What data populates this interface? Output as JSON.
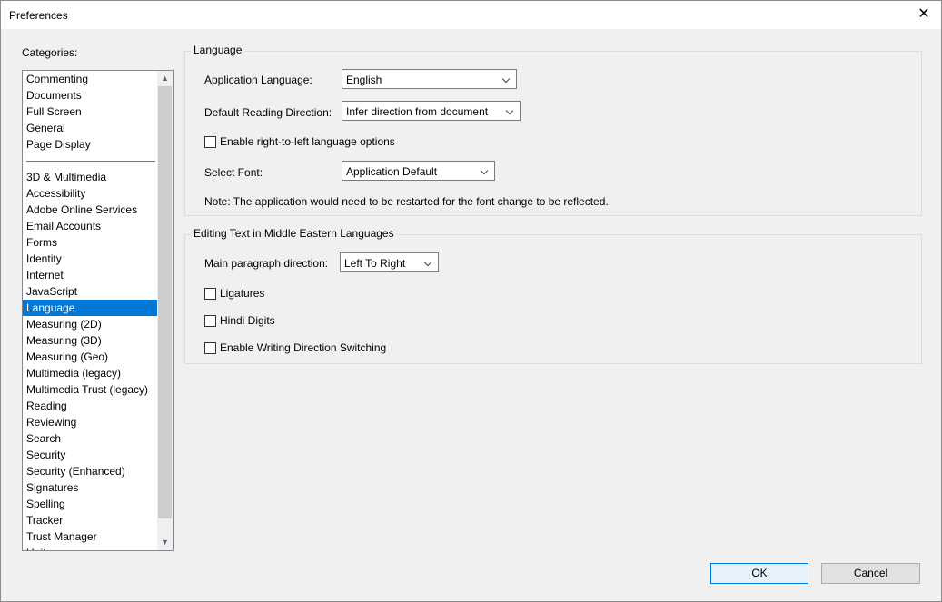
{
  "window": {
    "title": "Preferences"
  },
  "categories": {
    "label": "Categories:",
    "group1": [
      "Commenting",
      "Documents",
      "Full Screen",
      "General",
      "Page Display"
    ],
    "group2": [
      "3D & Multimedia",
      "Accessibility",
      "Adobe Online Services",
      "Email Accounts",
      "Forms",
      "Identity",
      "Internet",
      "JavaScript",
      "Language",
      "Measuring (2D)",
      "Measuring (3D)",
      "Measuring (Geo)",
      "Multimedia (legacy)",
      "Multimedia Trust (legacy)",
      "Reading",
      "Reviewing",
      "Search",
      "Security",
      "Security (Enhanced)",
      "Signatures",
      "Spelling",
      "Tracker",
      "Trust Manager",
      "Units"
    ],
    "selected": "Language"
  },
  "language": {
    "group_title": "Language",
    "app_language_label": "Application Language:",
    "app_language_value": "English",
    "reading_dir_label": "Default Reading Direction:",
    "reading_dir_value": "Infer direction from document",
    "rtl_option_label": "Enable right-to-left language options",
    "rtl_option_checked": false,
    "font_label": "Select Font:",
    "font_value": "Application Default",
    "note": "Note: The application would need to be restarted for the font change to be reflected."
  },
  "middle_east": {
    "group_title": "Editing Text in Middle Eastern Languages",
    "para_dir_label": "Main paragraph direction:",
    "para_dir_value": "Left To Right",
    "ligatures_label": "Ligatures",
    "hindi_digits_label": "Hindi Digits",
    "writing_dir_switch_label": "Enable Writing Direction Switching"
  },
  "buttons": {
    "ok": "OK",
    "cancel": "Cancel"
  }
}
